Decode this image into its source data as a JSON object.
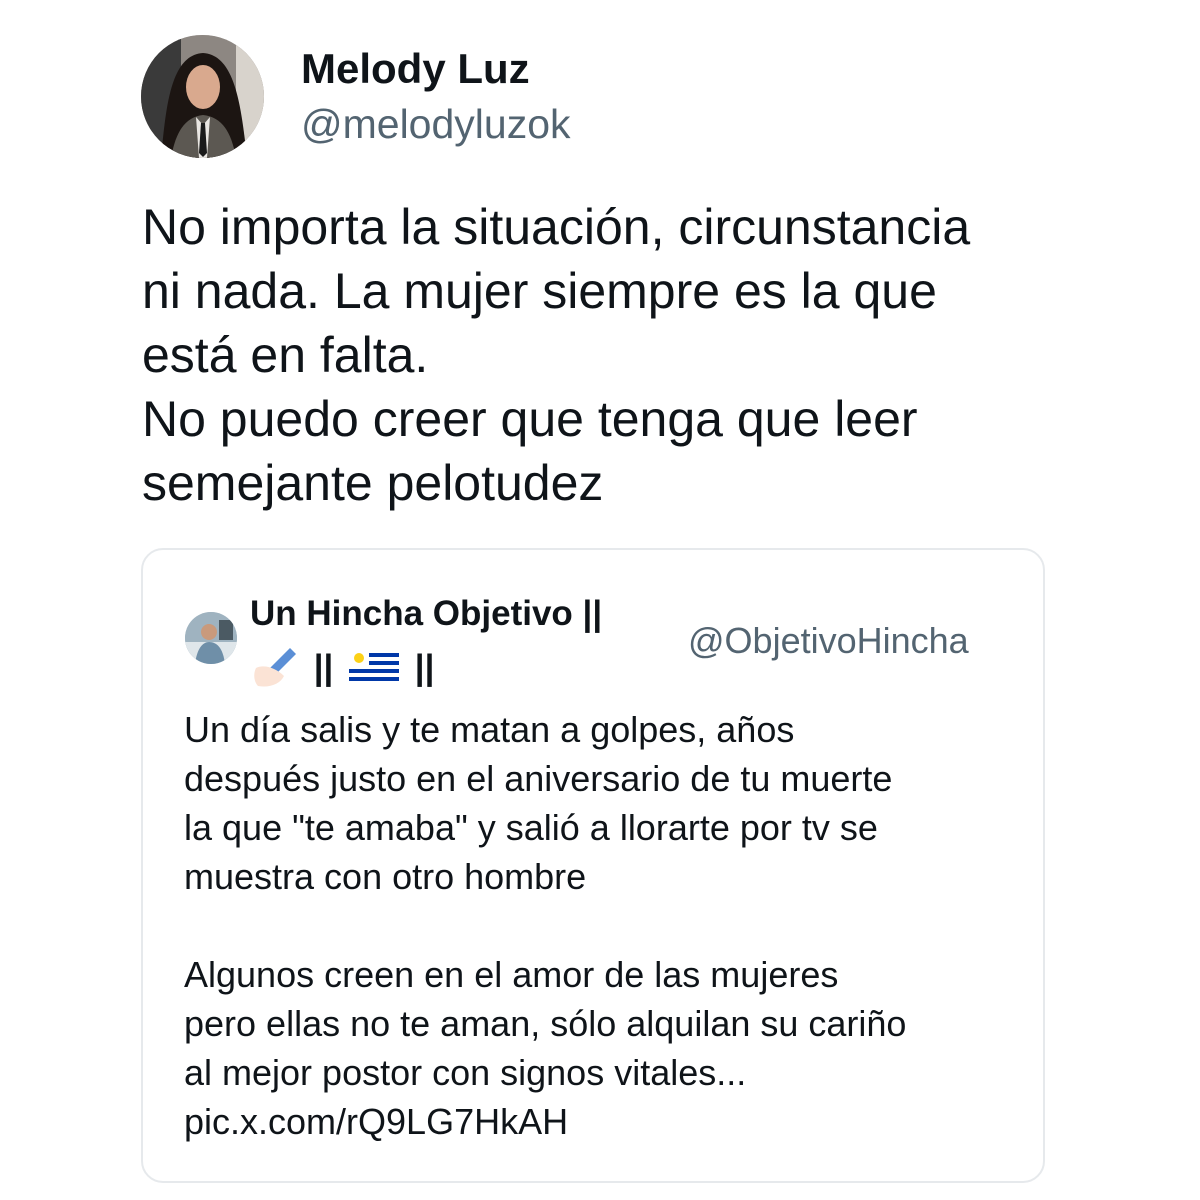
{
  "author": {
    "name": "Melody Luz",
    "handle": "@melodyluzok",
    "avatar_icon": "profile-photo"
  },
  "tweet": {
    "lines": [
      "No importa la situación, circunstancia",
      "ni nada. La mujer siempre es la que",
      "está en falta.",
      "No puedo creer que tenga que leer",
      "semejante pelotudez"
    ]
  },
  "quoted_tweet": {
    "name_line1": "Un Hincha Objetivo ||",
    "name_sep": "||",
    "name_sep2": "||",
    "name_emojis": [
      "writing-hand-emoji",
      "uruguay-flag-emoji"
    ],
    "handle": "@ObjetivoHincha",
    "avatar_icon": "profile-photo",
    "paragraph1": [
      "Un día salis y te matan a golpes, años",
      "después justo en el aniversario de tu muerte",
      "la que \"te amaba\" y salió a llorarte por tv se",
      "muestra con otro hombre"
    ],
    "paragraph2": [
      "Algunos creen en el amor de las mujeres",
      "pero ellas no te aman, sólo alquilan su cariño",
      "al mejor postor con signos vitales..."
    ],
    "link": "pic.x.com/rQ9LG7HkAH"
  },
  "colors": {
    "text": "#0f1419",
    "secondary": "#536471",
    "border": "#e6e9ec",
    "flag_blue": "#0038a8",
    "flag_sun": "#fcd116"
  }
}
